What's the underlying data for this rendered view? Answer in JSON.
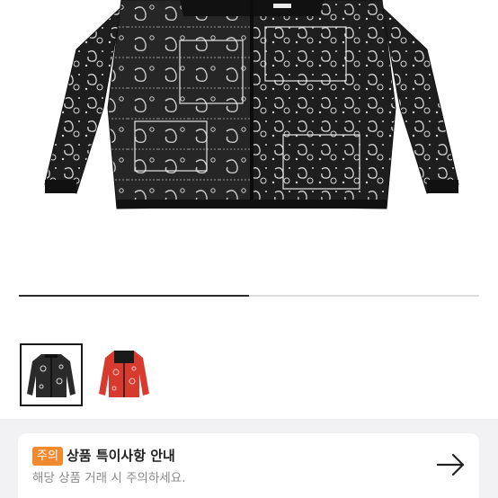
{
  "gallery": {
    "progress": 0.5,
    "images": [
      {
        "color": "#2a2a2a",
        "pattern": "#dcdcdc",
        "selected": true
      },
      {
        "color": "#d93a2f",
        "pattern": "#f4c7c0",
        "selected": false
      }
    ]
  },
  "notice": {
    "badge": "주의",
    "title": "상품 특이사항 안내",
    "subtitle": "해당 상품 거래 시 주의하세요.",
    "accent": "#f3892e",
    "icon": "arrow-right-icon"
  }
}
